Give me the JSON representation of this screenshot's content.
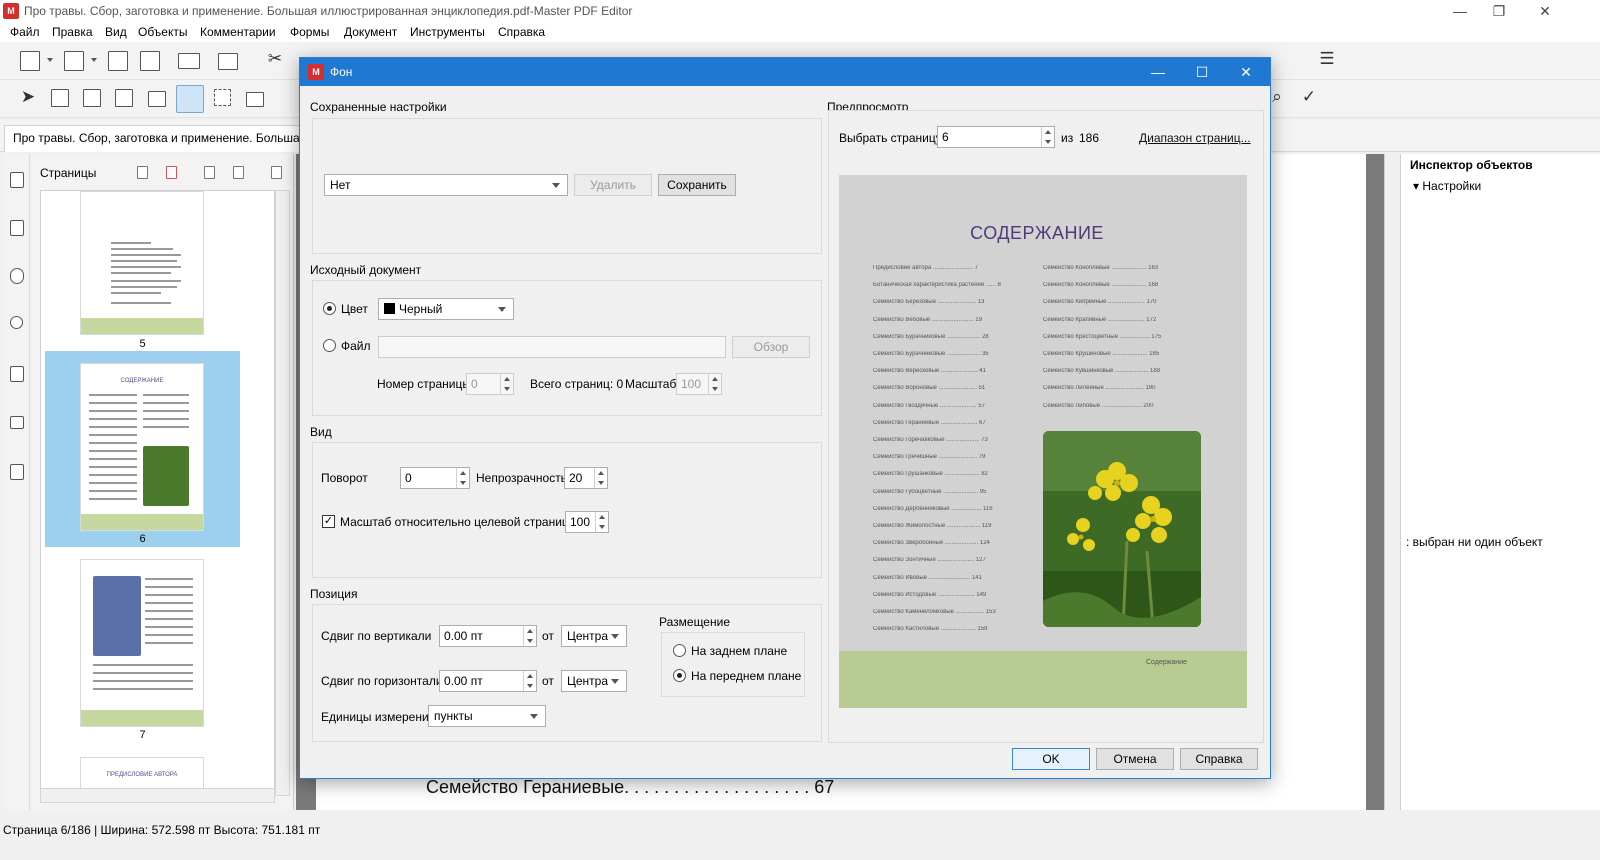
{
  "app": {
    "title": "Про травы. Сбор, заготовка и применение. Большая иллюстрированная энциклопедия.pdf-Master PDF Editor",
    "logo_text": "M"
  },
  "window_controls": {
    "minimize": "—",
    "maximize": "❐",
    "close": "✕"
  },
  "menu": [
    "Файл",
    "Правка",
    "Вид",
    "Объекты",
    "Комментарии",
    "Формы",
    "Документ",
    "Инструменты",
    "Справка"
  ],
  "doc_tab": {
    "title": "Про травы. Сбор, заготовка и применение. Большая илл"
  },
  "pages_panel": {
    "label": "Страницы",
    "thumbnails": [
      {
        "page": "5",
        "selected": false
      },
      {
        "page": "6",
        "selected": true,
        "heading": "СОДЕРЖАНИЕ"
      },
      {
        "page": "7",
        "selected": false
      },
      {
        "page": "",
        "selected": false,
        "heading": "ПРЕДИСЛОВИЕ АВТОРА"
      }
    ]
  },
  "document": {
    "visible_line": "Семейство Гераниевые. . . . . . . . . . . . . . . . . . .  67"
  },
  "inspector": {
    "title": "Инспектор объектов",
    "settings": "Настройки",
    "empty_message": ": выбран ни один объект"
  },
  "status": "Страница 6/186 | Ширина: 572.598 пт Высота: 751.181 пт",
  "dialog": {
    "title": "Фон",
    "controls": {
      "minimize": "—",
      "maximize": "☐",
      "close": "✕"
    },
    "saved_settings": {
      "label": "Сохраненные настройки",
      "selected": "Нет",
      "delete_button": "Удалить",
      "save_button": "Сохранить"
    },
    "source": {
      "label": "Исходный документ",
      "color_radio": "Цвет",
      "color_value": "Черный",
      "color_swatch": "#000000",
      "file_radio": "Файл",
      "file_path": "",
      "browse_button": "Обзор",
      "page_number_label": "Номер страницы",
      "page_number": "0",
      "total_pages_label": "Всего страниц: 0",
      "scale_label": "Масштаб",
      "scale": "100"
    },
    "view": {
      "label": "Вид",
      "rotation_label": "Поворот",
      "rotation": "0",
      "opacity_label": "Непрозрачность",
      "opacity": "20",
      "relative_scale_label": "Масштаб относительно целевой страницы",
      "relative_scale_checked": true,
      "relative_scale": "100"
    },
    "position": {
      "label": "Позиция",
      "vertical_offset_label": "Сдвиг по вертикали",
      "vertical_offset": "0.00 пт",
      "vertical_from_label": "от",
      "vertical_from": "Центра",
      "horizontal_offset_label": "Сдвиг по горизонтали",
      "horizontal_offset": "0.00 пт",
      "horizontal_from_label": "от",
      "horizontal_from": "Центра",
      "units_label": "Единицы измерения",
      "units": "пункты",
      "placement_label": "Размещение",
      "placement_back": "На заднем плане",
      "placement_front": "На переднем плане",
      "placement_selected": "front"
    },
    "preview": {
      "label": "Предпросмотр",
      "select_page_label": "Выбрать страницу",
      "page": "6",
      "of_label": "из",
      "total": "186",
      "range_link": "Диапазон страниц...",
      "page_heading": "СОДЕРЖАНИЕ",
      "page_footer": "Содержание",
      "left_column": [
        "Предисловие автора ........................ 7",
        "Ботаническая характеристика растений ...... 8",
        "Семейство Березовые ....................... 13",
        "Семейство Вебовые ......................... 19",
        "Семейство Бурачниковые .................... 28",
        "Семейство Бурачниковые .................... 35",
        "Семейство Вересковые ...................... 41",
        "Семейство Вороновые ....................... 51",
        "Семейство Гвоздичные ...................... 57",
        "Семейство Гераниевые ...................... 67",
        "Семейство Горечавковые .................... 73",
        "Семейство Гречишные ....................... 79",
        "Семейство Грушанковые ..................... 82",
        "Семейство Губоцветные ..................... 95",
        "Семейство Дербенниковые .................. 116",
        "Семейство Жимолостные .................... 119",
        "Семейство Зверобойные .................... 124",
        "Семейство Зонтичные ...................... 127",
        "Семейство Ивовые ......................... 141",
        "Семейство Истодовые ...................... 149",
        "Семейство Каменеломковые ................. 153",
        "Семейство Кастиловые ..................... 159"
      ],
      "right_column": [
        "Семейство Коноплевые ..................... 163",
        "Семейство Коноплевые ..................... 168",
        "Семейство Кипрейные ...................... 170",
        "Семейство Крапивные ...................... 172",
        "Семейство Крестоцветные .................. 175",
        "Семейство Крушиновые ..................... 185",
        "Семейство Кувшинковые .................... 188",
        "Семейство Лилейные ....................... 190",
        "Семейство Липовые ........................ 200"
      ]
    },
    "buttons": {
      "ok": "OK",
      "cancel": "Отмена",
      "help": "Справка"
    }
  }
}
